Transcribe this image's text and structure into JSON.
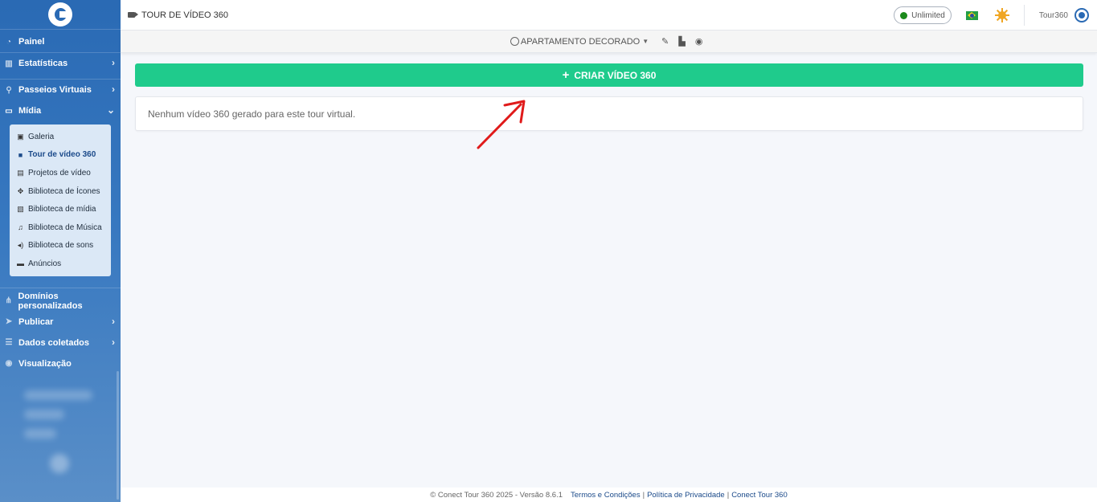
{
  "header": {
    "title": "TOUR DE VÍDEO 360",
    "plan_badge": "Unlimited",
    "user": "Tour360"
  },
  "subheader": {
    "tour_name": "APARTAMENTO DECORADO"
  },
  "sidebar": {
    "items": [
      {
        "label": "Painel",
        "icon": "dashboard-icon"
      },
      {
        "label": "Estatísticas",
        "icon": "chart-icon",
        "chevron": true
      },
      {
        "label": "Passeios Virtuais",
        "icon": "route-icon",
        "chevron": true
      },
      {
        "label": "Mídia",
        "icon": "monitor-icon",
        "chevron": true,
        "expanded": true
      }
    ],
    "media_submenu": [
      {
        "label": "Galeria",
        "icon": "gallery-icon"
      },
      {
        "label": "Tour de vídeo 360",
        "icon": "video-camera-icon",
        "active": true
      },
      {
        "label": "Projetos de vídeo",
        "icon": "film-icon"
      },
      {
        "label": "Biblioteca de Ícones",
        "icon": "icons-icon"
      },
      {
        "label": "Biblioteca de mídia",
        "icon": "photo-library-icon"
      },
      {
        "label": "Biblioteca de Música",
        "icon": "music-icon"
      },
      {
        "label": "Biblioteca de sons",
        "icon": "volume-icon"
      },
      {
        "label": "Anúncios",
        "icon": "ad-icon"
      }
    ],
    "items_after": [
      {
        "label": "Domínios personalizados",
        "icon": "sitemap-icon"
      },
      {
        "label": "Publicar",
        "icon": "paper-plane-icon",
        "chevron": true
      },
      {
        "label": "Dados coletados",
        "icon": "database-icon",
        "chevron": true
      },
      {
        "label": "Visualização",
        "icon": "eye-icon"
      }
    ]
  },
  "main": {
    "create_button": "CRIAR VÍDEO 360",
    "empty_message": "Nenhum vídeo 360 gerado para este tour virtual."
  },
  "footer": {
    "copyright": "© Conect Tour 360 2025 - Versão 8.6.1",
    "terms": "Termos e Condições",
    "privacy": "Política de Privacidade",
    "brand": "Conect Tour 360"
  },
  "colors": {
    "sidebar": "#2a6ab4",
    "primary_button": "#1fcb8c",
    "status_dot": "#1b8a1b"
  }
}
